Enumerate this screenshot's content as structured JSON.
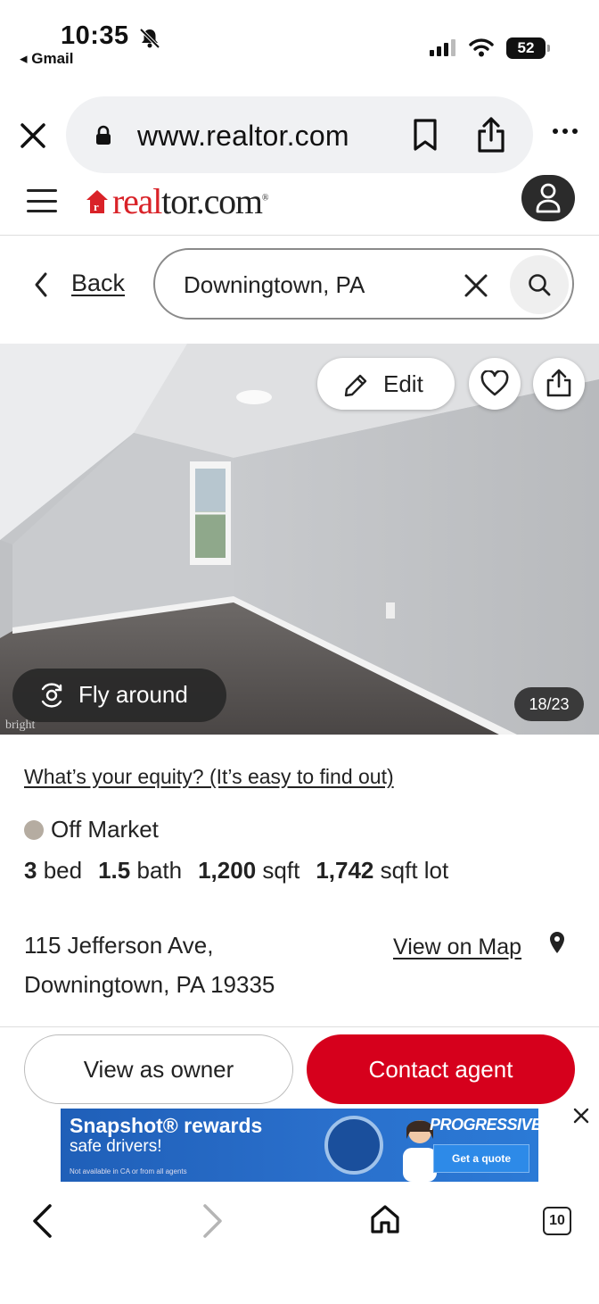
{
  "status_bar": {
    "time": "10:35",
    "back_app": "◂ Gmail",
    "battery": "52"
  },
  "browser": {
    "url": "www.realtor.com"
  },
  "site": {
    "logo_real": "real",
    "logo_tor": "tor.com",
    "brand_color": "#d92228"
  },
  "search": {
    "back_label": "Back",
    "value": "Downingtown, PA"
  },
  "photo": {
    "edit_label": "Edit",
    "fly_label": "Fly around",
    "counter": "18/23",
    "watermark": "bright"
  },
  "listing": {
    "equity_link": "What’s your equity? (It’s easy to find out)",
    "status": "Off Market",
    "beds_value": "3",
    "beds_unit": "bed",
    "baths_value": "1.5",
    "baths_unit": "bath",
    "sqft_value": "1,200",
    "sqft_unit": "sqft",
    "lot_value": "1,742",
    "lot_unit": "sqft lot",
    "address_line1": "115 Jefferson Ave,",
    "address_line2": "Downingtown, PA 19335",
    "map_link": "View on Map"
  },
  "cta": {
    "owner_label": "View as owner",
    "contact_label": "Contact agent",
    "contact_color": "#d6001c"
  },
  "ad": {
    "title": "Snapshot® rewards",
    "subtitle": "safe drivers!",
    "fine_print": "Not available in CA or from all agents",
    "brand": "PROGRESSIVE",
    "cta": "Get a quote"
  },
  "bottom_nav": {
    "tabs_count": "10"
  }
}
